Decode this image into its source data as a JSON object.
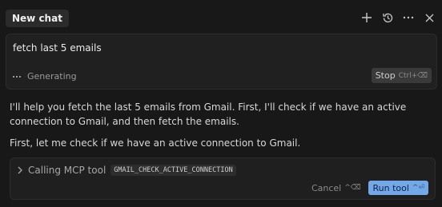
{
  "header": {
    "tab_label": "New chat",
    "icons": [
      "plus-icon",
      "history-icon",
      "more-icon",
      "close-icon"
    ]
  },
  "input": {
    "prompt": "fetch last 5 emails",
    "status": "Generating",
    "stop_label": "Stop",
    "stop_shortcut": "Ctrl+⌫"
  },
  "messages": {
    "p1": "I'll help you fetch the last 5 emails from Gmail. First, I'll check if we have an active connection to Gmail, and then fetch the emails.",
    "p2": "First, let me check if we have an active connection to Gmail."
  },
  "tool": {
    "label": "Calling MCP tool",
    "name": "GMAIL_CHECK_ACTIVE_CONNECTION",
    "cancel_label": "Cancel",
    "cancel_shortcut": "^⌫",
    "run_label": "Run tool",
    "run_shortcut": "^⏎"
  },
  "colors": {
    "background": "#181818",
    "run_button": "#73a8e8"
  }
}
